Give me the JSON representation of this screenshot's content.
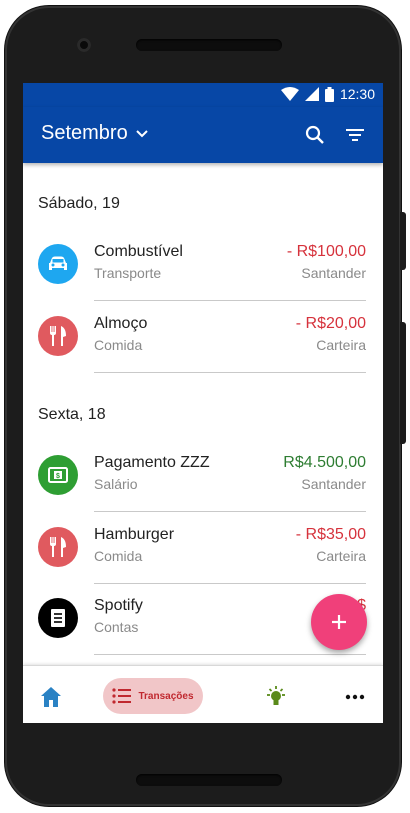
{
  "statusbar": {
    "time": "12:30"
  },
  "appbar": {
    "month": "Setembro"
  },
  "days": [
    {
      "label": "Sábado, 19",
      "transactions": [
        {
          "name": "Combustível",
          "category": "Transporte",
          "amount": "- R$100,00",
          "account": "Santander",
          "icon": "car-icon",
          "icon_color": "#1ea7f0",
          "kind": "negative"
        },
        {
          "name": "Almoço",
          "category": "Comida",
          "amount": "- R$20,00",
          "account": "Carteira",
          "icon": "utensils-icon",
          "icon_color": "#e05a5f",
          "kind": "negative"
        }
      ]
    },
    {
      "label": "Sexta, 18",
      "transactions": [
        {
          "name": "Pagamento ZZZ",
          "category": "Salário",
          "amount": "R$4.500,00",
          "account": "Santander",
          "icon": "money-icon",
          "icon_color": "#2e9e33",
          "kind": "positive"
        },
        {
          "name": "Hamburger",
          "category": "Comida",
          "amount": "- R$35,00",
          "account": "Carteira",
          "icon": "utensils-icon",
          "icon_color": "#e05a5f",
          "kind": "negative"
        },
        {
          "name": "Spotify",
          "category": "Contas",
          "amount": "- R$",
          "account": "S",
          "icon": "receipt-icon",
          "icon_color": "#000000",
          "kind": "negative"
        }
      ]
    }
  ],
  "bottomnav": {
    "transactions_label": "Transações",
    "home_color": "#2a82c4",
    "active_bg": "#f1c6c8",
    "tips_color": "#5a8a1a"
  },
  "colors": {
    "primary": "#0747a6",
    "accent": "#f0407a",
    "negative": "#d6323c",
    "positive": "#2e7d32"
  }
}
